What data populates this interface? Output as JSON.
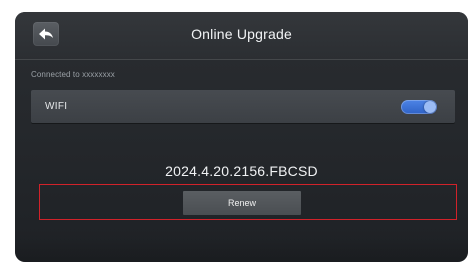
{
  "header": {
    "title": "Online Upgrade",
    "back_icon": "back-arrow-icon"
  },
  "status": {
    "connected_text": "Connected to xxxxxxxx"
  },
  "wifi": {
    "label": "WIFI",
    "enabled": true,
    "toggle_color": "#3a6fd6"
  },
  "version": {
    "text": "2024.4.20.2156.FBCSD"
  },
  "action": {
    "renew_label": "Renew",
    "highlight_color": "#d1222a"
  }
}
